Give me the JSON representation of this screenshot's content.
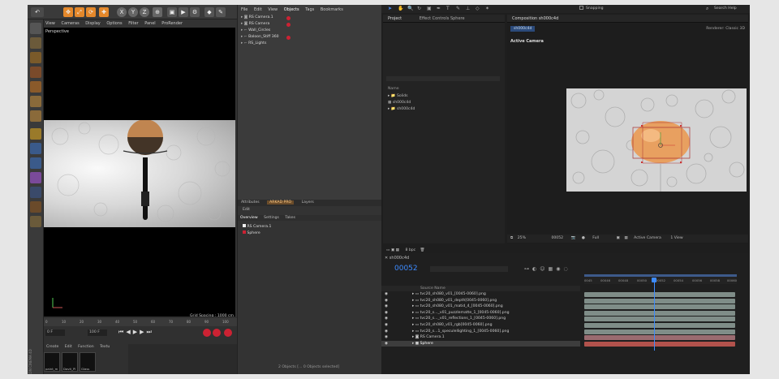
{
  "c4d": {
    "toolbar_icons": [
      "undo-icon",
      "move-icon",
      "scale-icon",
      "rotate-icon",
      "x-axis-icon",
      "y-axis-icon",
      "z-axis-icon",
      "render-icon"
    ],
    "axis_labels": [
      "X",
      "Y",
      "Z"
    ],
    "viewport_menu": [
      "View",
      "Cameras",
      "Display",
      "Options",
      "Filter",
      "Panel",
      "ProRender"
    ],
    "viewport_label": "Perspective",
    "grid_spacing": "Grid Spacing : 1000 cm",
    "om_menu": [
      "File",
      "Edit",
      "View",
      "Objects",
      "Tags",
      "Bookmarks"
    ],
    "objects": [
      "RS Camera.1",
      "RS Camera",
      "Wall_Circles",
      "Baloon_Stiff 360",
      "RS_Lights"
    ],
    "attr_tabs": [
      "Attributes",
      "ARKAD PRO",
      "Layers"
    ],
    "attr_edit": "Edit",
    "attr_subtabs": [
      "Overview",
      "Settings",
      "Takes"
    ],
    "takes": [
      "RS Camera.1",
      "Sphere"
    ],
    "status": "2 Objects [... 0 Objects selected]",
    "frame_start": "0 F",
    "frame_end": "100 F",
    "frame_ticks": [
      "0",
      "10",
      "20",
      "30",
      "40",
      "50",
      "60",
      "70",
      "80",
      "90",
      "100"
    ],
    "material_menu": [
      "Create",
      "Edit",
      "Function",
      "Textu"
    ],
    "materials": [
      "paint_m",
      "Davit_Pl",
      "Glass"
    ],
    "side_label": "MAXON CINEMA 4D"
  },
  "ae": {
    "search_placeholder": "Search Help",
    "snapping": "Snapping",
    "project_tab": "Project",
    "effect_tab": "Effect Controls Sphere",
    "composition_tab": "Composition sh000c4d",
    "comp_crumb": "sh000c4d",
    "renderer": "Renderer:  Classic 3D",
    "active_camera_label": "Active Camera",
    "project_name_header": "Name",
    "project_items": [
      "Solids",
      "sh000c4d",
      "sh000c4d"
    ],
    "bpc": "8 bpc",
    "zoom": "25%",
    "timecode": "00052",
    "resolution": "Full",
    "camera_select": "Active Camera",
    "view_select": "1 View",
    "tl_tab": "sh000c4d",
    "tl_timecode": "00052",
    "source_name_header": "Source Name",
    "layers": [
      "tvc20_sh080_v01_[0045-0060].png",
      "tvc20_sh080_v01_depth[0045-0060].png",
      "tvc20_sh080_v01_matid_4_[0045-0060].png",
      "tvc20_s..._v01_puzzlematte_1_[0045-0060].png",
      "tvc20_s..._v01_reflections_1_[0045-0060].png",
      "tvc20_sh080_v01_rgb[0045-0060].png",
      "tvc20_s...1_speculellighting_1_[0045-0060].png",
      "RS Camera.1",
      "Sphere"
    ],
    "ruler": [
      "0045",
      "00046",
      "00048",
      "00050",
      "00052",
      "00054",
      "00056",
      "00058",
      "00060"
    ],
    "colors": {
      "blue_accent": "#2d8cff",
      "layer_bar": "#7f8d88",
      "sphere_bar": "#b2524c",
      "camera_bar": "#9a6b70"
    }
  }
}
